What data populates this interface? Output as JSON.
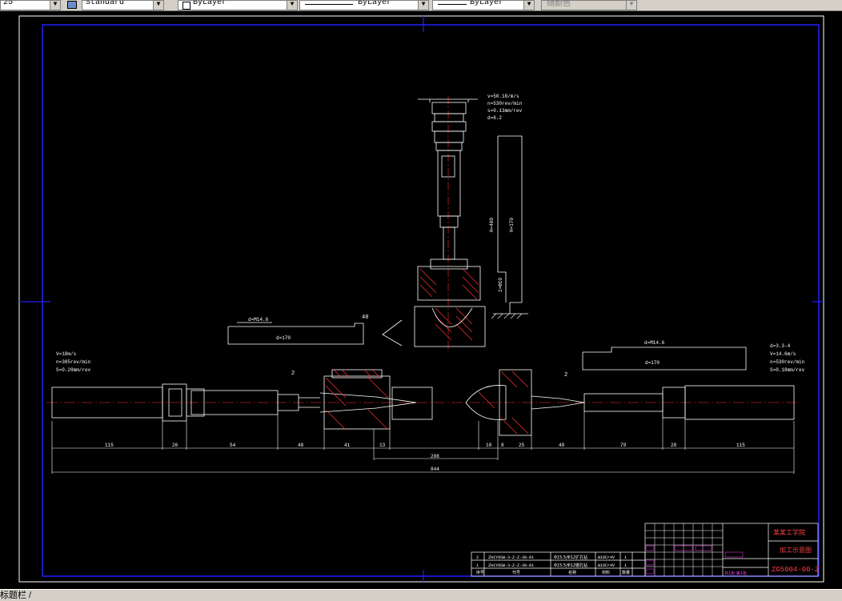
{
  "toolbar": {
    "scale_value": "25",
    "text_style": "Standard",
    "layer_value": "ByLayer",
    "linetype_value": "ByLayer",
    "lineweight_value": "ByLayer",
    "color_value": "随颜色"
  },
  "drawing": {
    "top_note": [
      "v=50.18/m/s",
      "n=530rev/min",
      "s=0.13mm/rev",
      "d=6.2"
    ],
    "left_note": [
      "V=18m/s",
      "n=305rev/min",
      "S=0.28mm/rev"
    ],
    "right_note": [
      "d=3.3-4",
      "V=14.6m/s",
      "n=530rev/min",
      "S=0.18mm/rev"
    ],
    "left_bar_label": "d=M14.6",
    "left_bar_value": "d=170",
    "right_bar_label": "d=M14.6",
    "right_bar_value": "d=170",
    "dim_40": "40",
    "dim_10_left": "10",
    "dim_10_right": "10",
    "bubble_2a": "2",
    "bubble_2b": "2",
    "dim_bottom": [
      "115",
      "26",
      "54",
      "48",
      "41",
      "13",
      "10",
      "8",
      "25",
      "48",
      "79",
      "28",
      "115"
    ],
    "dim_208": "208",
    "dim_844": "844",
    "vertical_label_1": "H=400",
    "vertical_label_2": "H=170",
    "vertical_label_3": "1×Φ10"
  },
  "titleblock": {
    "school": "某某工学院",
    "drawing_name": "加工示意图",
    "drawing_no": "ZG5004-00-Z",
    "sheet": "共1张 第1张",
    "parts": [
      {
        "no": "2",
        "code": "ZH1Y0SW-3-Z-Z-30-01",
        "name": "Φ15.5/Φ12扩孔钻",
        "mat": "W18Cr4V",
        "qty": "1"
      },
      {
        "no": "1",
        "code": "ZH1Y0SW-3-Z-Z-30-01",
        "name": "Φ15.5/Φ12锪孔钻",
        "mat": "W18Cr4V",
        "qty": "1"
      }
    ],
    "headers": [
      "序号",
      "代号",
      "名称",
      "材料",
      "数量"
    ]
  },
  "statusbar": {
    "label": "标题栏 /"
  }
}
